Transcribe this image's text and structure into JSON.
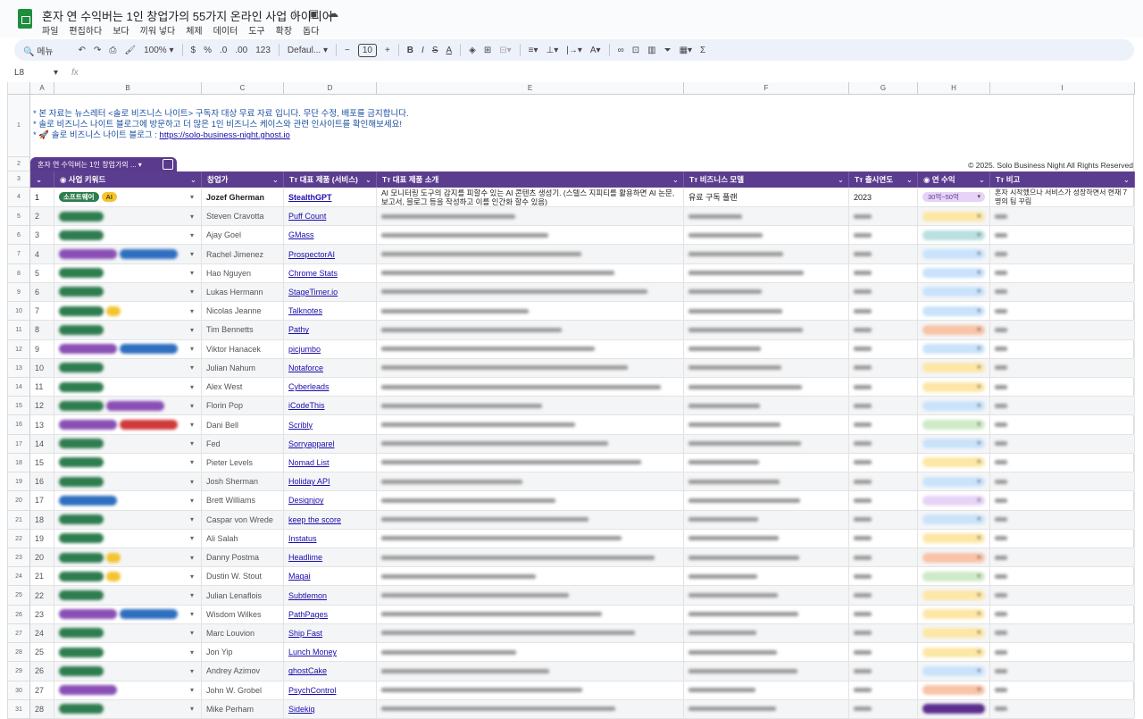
{
  "doc": {
    "title": "혼자 연 수익버는 1인 창업가의 55가지 온라인 사업 아이디어",
    "menu": [
      "파일",
      "편집하다",
      "보다",
      "끼워 넣다",
      "체제",
      "데이터",
      "도구",
      "확장",
      "돕다"
    ]
  },
  "toolbar": {
    "search": "메뉴",
    "zoom": "100%",
    "currency": "$",
    "percent": "%",
    "dec_less": ".0",
    "dec_more": ".00",
    "number_format": "123",
    "font": "Defaul...",
    "font_size": "10"
  },
  "formula_bar": {
    "cell_ref": "L8",
    "fx": "fx"
  },
  "columns": [
    "A",
    "B",
    "C",
    "D",
    "E",
    "F",
    "G",
    "H",
    "I"
  ],
  "notice": {
    "line1": "* 본 자료는 뉴스레터 <솔로 비즈니스 나이트> 구독자 대상 무료 자료 입니다. 무단 수정, 배포를 금지합니다.",
    "line2": "* 솔로 비즈니스 나이트 블로그에 방문하고 더 많은 1인 비즈니스 케이스와 관련 인사이트를 확인해보세요!",
    "line3_label": "* 🚀 솔로 비즈니스 나이트 블로그 : ",
    "link": "https://solo-business-night.ghost.io"
  },
  "table_tab": "혼자 연 수익버는 1인 창업가의 ...",
  "copyright": "© 2025. Solo Business Night All Rights Reserved",
  "headers": [
    "사업 키워드",
    "창업가",
    "대표 제품 (서비스)",
    "대표 제품 소개",
    "비즈니스 모델",
    "출시연도",
    "연 수익",
    "비고"
  ],
  "first_row": {
    "no": "1",
    "tags": [
      {
        "label": "소프트웨어",
        "color": "#2e7d4f"
      },
      {
        "label": "AI",
        "color": "#f4c430"
      }
    ],
    "founder": "Jozef Gherman",
    "product": "StealthGPT",
    "description": "AI 모니터링 도구의 감지를 피할수 있는 AI 콘텐츠 생성기. (스텔스 지피티를 활용하면 AI 논문, 보고서, 블로그 등을 작성하고 이를 인간화 할수 있음)",
    "model": "유료 구독 플랜",
    "year": "2023",
    "revenue": "30억~50억",
    "note": "혼자 시작했으나 서비스가 성장하면서 현재 7명의 팀 꾸림"
  },
  "rows": [
    {
      "no": "2",
      "founder": "Steven Cravotta",
      "product": "Puff Count",
      "tags": [
        "green"
      ],
      "rev": "#fde7a6"
    },
    {
      "no": "3",
      "founder": "Ajay Goel",
      "product": "GMass",
      "tags": [
        "green"
      ],
      "rev": "#b9dfe0"
    },
    {
      "no": "4",
      "founder": "Rachel Jimenez",
      "product": "ProspectorAI",
      "tags": [
        "purple",
        "blue"
      ],
      "rev": "#c9e3fb"
    },
    {
      "no": "5",
      "founder": "Hao Nguyen",
      "product": "Chrome Stats",
      "tags": [
        "green"
      ],
      "rev": "#c9e3fb"
    },
    {
      "no": "6",
      "founder": "Lukas Hermann",
      "product": "StageTimer.io",
      "tags": [
        "green"
      ],
      "rev": "#c9e3fb"
    },
    {
      "no": "7",
      "founder": "Nicolas Jeanne",
      "product": "Talknotes",
      "tags": [
        "green",
        "yellow"
      ],
      "rev": "#c9e3fb"
    },
    {
      "no": "8",
      "founder": "Tim Bennetts",
      "product": "Pathy",
      "tags": [
        "green"
      ],
      "rev": "#f9c3a8"
    },
    {
      "no": "9",
      "founder": "Viktor Hanacek",
      "product": "picjumbo",
      "tags": [
        "purple",
        "blue"
      ],
      "rev": "#c9e3fb"
    },
    {
      "no": "10",
      "founder": "Julian Nahum",
      "product": "Notaforce",
      "tags": [
        "green"
      ],
      "rev": "#fde7a6"
    },
    {
      "no": "11",
      "founder": "Alex West",
      "product": "Cyberleads",
      "tags": [
        "green"
      ],
      "rev": "#fde7a6"
    },
    {
      "no": "12",
      "founder": "Florin Pop",
      "product": "iCodeThis",
      "tags": [
        "green",
        "purple"
      ],
      "rev": "#c9e3fb"
    },
    {
      "no": "13",
      "founder": "Dani Bell",
      "product": "Scribly",
      "tags": [
        "purple",
        "red"
      ],
      "rev": "#cfeac8"
    },
    {
      "no": "14",
      "founder": "Fed",
      "product": "Sorryapparel",
      "tags": [
        "green"
      ],
      "rev": "#c9e3fb"
    },
    {
      "no": "15",
      "founder": "Pieter Levels",
      "product": "Nomad List",
      "tags": [
        "green"
      ],
      "rev": "#fde7a6"
    },
    {
      "no": "16",
      "founder": "Josh Sherman",
      "product": "Holiday API",
      "tags": [
        "green"
      ],
      "rev": "#c9e3fb"
    },
    {
      "no": "17",
      "founder": "Brett Williams",
      "product": "Designjoy",
      "tags": [
        "blue"
      ],
      "rev": "#e6d3f7"
    },
    {
      "no": "18",
      "founder": "Caspar von Wrede",
      "product": "keep the score",
      "tags": [
        "green"
      ],
      "rev": "#c9e3fb"
    },
    {
      "no": "19",
      "founder": "Ali Salah",
      "product": "Instatus",
      "tags": [
        "green"
      ],
      "rev": "#fde7a6"
    },
    {
      "no": "20",
      "founder": "Danny Postma",
      "product": "Headlime",
      "tags": [
        "green",
        "yellow"
      ],
      "rev": "#f9c3a8"
    },
    {
      "no": "21",
      "founder": "Dustin W. Stout",
      "product": "Magai",
      "tags": [
        "green",
        "yellow"
      ],
      "rev": "#cfeac8"
    },
    {
      "no": "22",
      "founder": "Julian Lenaflois",
      "product": "Subtlemon",
      "tags": [
        "green"
      ],
      "rev": "#fde7a6"
    },
    {
      "no": "23",
      "founder": "Wisdom Wilkes",
      "product": "PathPages",
      "tags": [
        "purple",
        "blue"
      ],
      "rev": "#fde7a6"
    },
    {
      "no": "24",
      "founder": "Marc Louvion",
      "product": "Ship Fast",
      "tags": [
        "green"
      ],
      "rev": "#fde7a6"
    },
    {
      "no": "25",
      "founder": "Jon Yip",
      "product": "Lunch Money",
      "tags": [
        "green"
      ],
      "rev": "#fde7a6"
    },
    {
      "no": "26",
      "founder": "Andrey Azimov",
      "product": "ghostCake",
      "tags": [
        "green"
      ],
      "rev": "#c9e3fb"
    },
    {
      "no": "27",
      "founder": "John W. Grobel",
      "product": "PsychControl",
      "tags": [
        "purple"
      ],
      "rev": "#f9c3a8"
    },
    {
      "no": "28",
      "founder": "Mike Perham",
      "product": "Sidekiq",
      "tags": [
        "green"
      ],
      "rev": "#5b2d8f"
    }
  ],
  "colors": {
    "green": "#2e7d4f",
    "purple": "#8a4fb5",
    "blue": "#2f6fc0",
    "yellow": "#f4c430",
    "red": "#d03a3a",
    "header": "#5b3d8f"
  }
}
